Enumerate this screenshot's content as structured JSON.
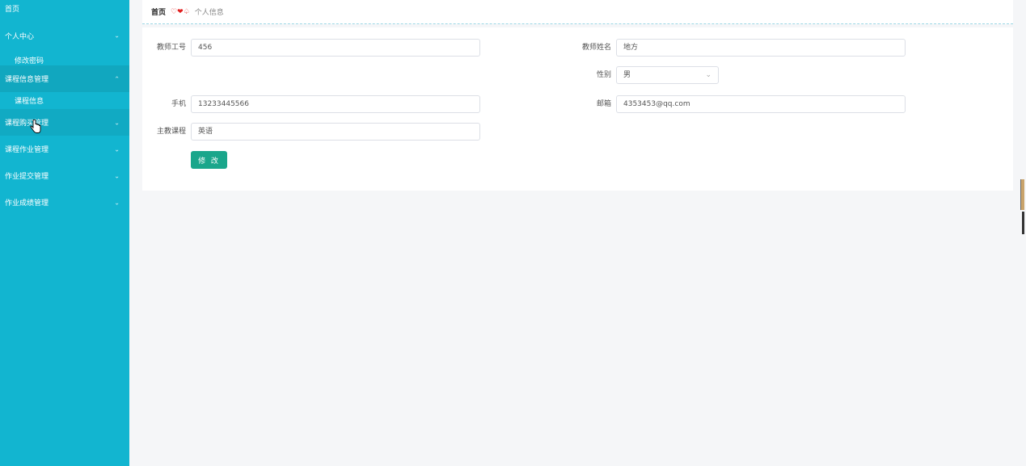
{
  "sidebar": {
    "home": "首页",
    "personal_center": "个人中心",
    "change_password": "修改密码",
    "course_info_mgmt": "课程信息管理",
    "course_info": "课程信息",
    "course_purchase_mgmt": "课程购买管理",
    "course_homework_mgmt": "课程作业管理",
    "homework_submit_mgmt": "作业提交管理",
    "homework_score_mgmt": "作业成绩管理"
  },
  "breadcrumb": {
    "home": "首页",
    "separator": "♡❤♤",
    "current": "个人信息"
  },
  "form": {
    "teacher_id_label": "教师工号",
    "teacher_id_value": "456",
    "teacher_name_label": "教师姓名",
    "teacher_name_value": "地方",
    "gender_label": "性别",
    "gender_value": "男",
    "phone_label": "手机",
    "phone_value": "13233445566",
    "email_label": "邮箱",
    "email_value": "4353453@qq.com",
    "course_label": "主教课程",
    "course_value": "英语",
    "submit_label": "修 改"
  },
  "colors": {
    "sidebar_bg": "#12b5d0",
    "button_bg": "#1aa68b",
    "breadcrumb_sep": "#e01e1e"
  }
}
